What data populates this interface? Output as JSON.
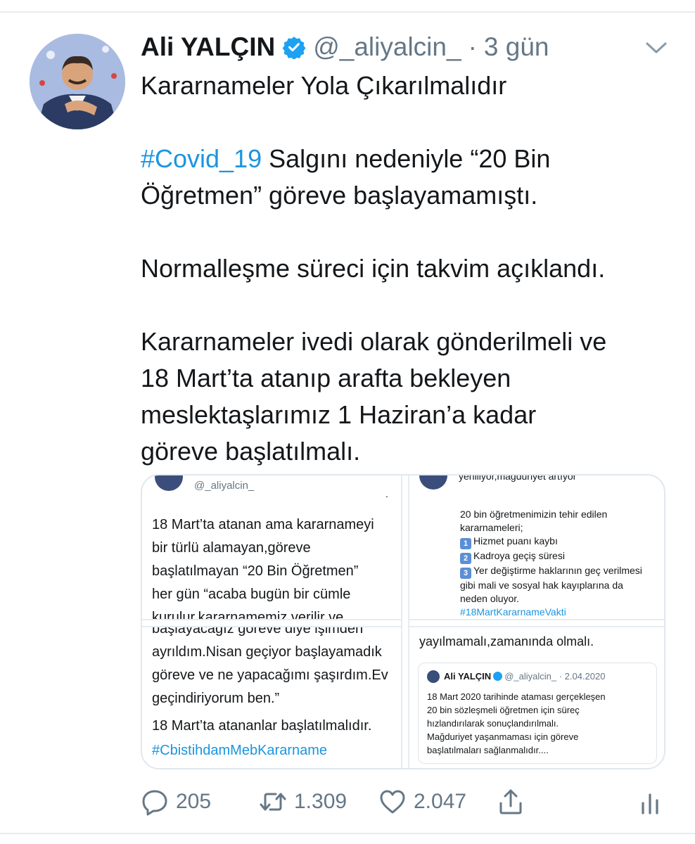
{
  "tweet": {
    "author_name": "Ali YALÇIN",
    "handle": "@_aliyalcin_",
    "separator": "·",
    "time": "3 gün",
    "lines": {
      "l1": "Kararnameler Yola Çıkarılmalıdır",
      "hashtag": "#Covid_19",
      "l2_rest": " Salgını nedeniyle “20 Bin",
      "l3": "Öğretmen” göreve başlayamamıştı.",
      "l4": "Normalleşme süreci için takvim açıklandı.",
      "l5": "Kararnameler ivedi olarak gönderilmeli ve",
      "l6": "18 Mart’ta atanıp arafta bekleyen",
      "l7": "meslektaşlarımız 1 Haziran’a kadar",
      "l8": "göreve başlatılmalı."
    }
  },
  "media": {
    "pane1": {
      "handle": "@_aliyalcin_",
      "dot": ".",
      "lines": [
        "18 Mart’ta atanan ama kararnameyi",
        "bir türlü alamayan,göreve",
        "başlatılmayan “20 Bin Öğretmen”",
        "her gün “acaba bugün bir cümle",
        "kurulur,kararnamemiz verilir ve"
      ]
    },
    "pane2": {
      "top_line": "yeniliyor,mağduriyet artıyor”",
      "l1": "20 bin öğretmenimizin tehir edilen",
      "l2": "kararnameleri;",
      "n1": "1",
      "i1": "Hizmet puanı kaybı",
      "n2": "2",
      "i2": "Kadroya geçiş süresi",
      "n3": "3",
      "i3": "Yer değiştirme haklarının geç verilmesi",
      "l3": "gibi mali ve sosyal hak kayıplarına da",
      "l4": "neden oluyor.",
      "hashtag": "#18MartKararnameVakti"
    },
    "pane3": {
      "lines": [
        "başlayacağız göreve diye işimden",
        "ayrıldım.Nisan geçiyor başlayamadık",
        "göreve ve ne yapacağımı şaşırdım.Ev",
        "geçindiriyorum ben.”"
      ],
      "closing": "18 Mart’ta atananlar başlatılmalıdır.",
      "hashtag": "#CbistihdamMebKararname"
    },
    "pane4": {
      "lead": "yayılmamalı,zamanında olmalı.",
      "card_name": "Ali YALÇIN",
      "card_meta": "@_aliyalcin_ · 2.04.2020",
      "card_lines": [
        "18 Mart 2020 tarihinde ataması gerçekleşen",
        "20 bin sözleşmeli öğretmen için süreç",
        "hızlandırılarak sonuçlandırılmalı.",
        "Mağduriyet yaşanmaması için göreve",
        "başlatılmaları sağlanmalıdır...."
      ]
    }
  },
  "actions": {
    "reply_count": "205",
    "retweet_count": "1.309",
    "like_count": "2.047"
  },
  "colors": {
    "link": "#1b95e0",
    "verified": "#1da1f2",
    "muted": "#657786",
    "text": "#14171a"
  },
  "icons": [
    "verified-badge-icon",
    "chevron-down-icon",
    "reply-icon",
    "retweet-icon",
    "like-icon",
    "share-icon",
    "analytics-icon"
  ]
}
